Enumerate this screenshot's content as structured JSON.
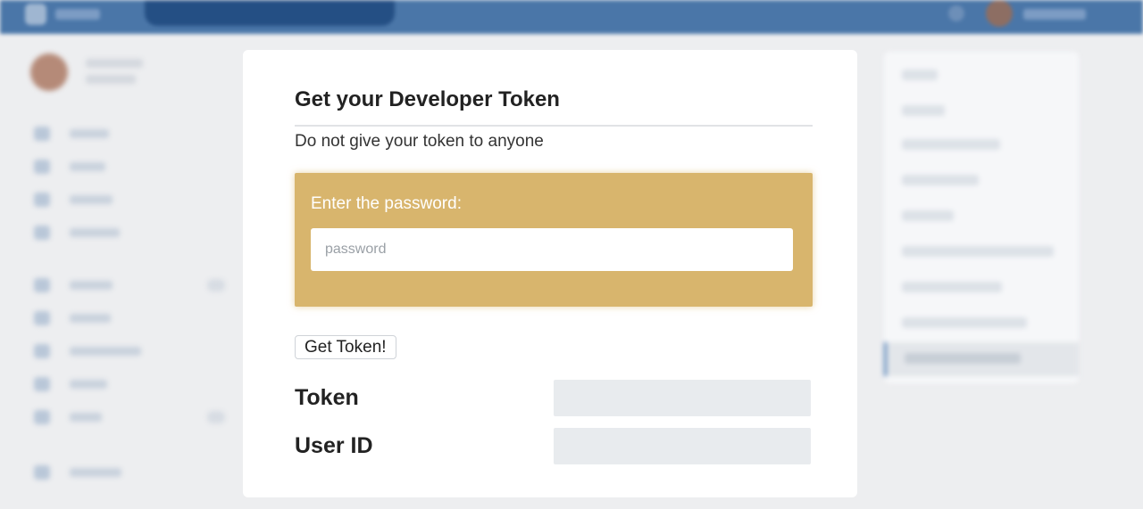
{
  "form": {
    "title": "Get your Developer Token",
    "warning": "Do not give your token to anyone",
    "password_label": "Enter the password:",
    "password_value": "",
    "password_placeholder": "password",
    "submit_label": "Get Token!",
    "token_label": "Token",
    "token_value": "",
    "user_id_label": "User ID",
    "user_id_value": ""
  },
  "colors": {
    "topbar": "#4a76a8",
    "panel": "#d8b56d",
    "page_background": "#edeef0"
  }
}
